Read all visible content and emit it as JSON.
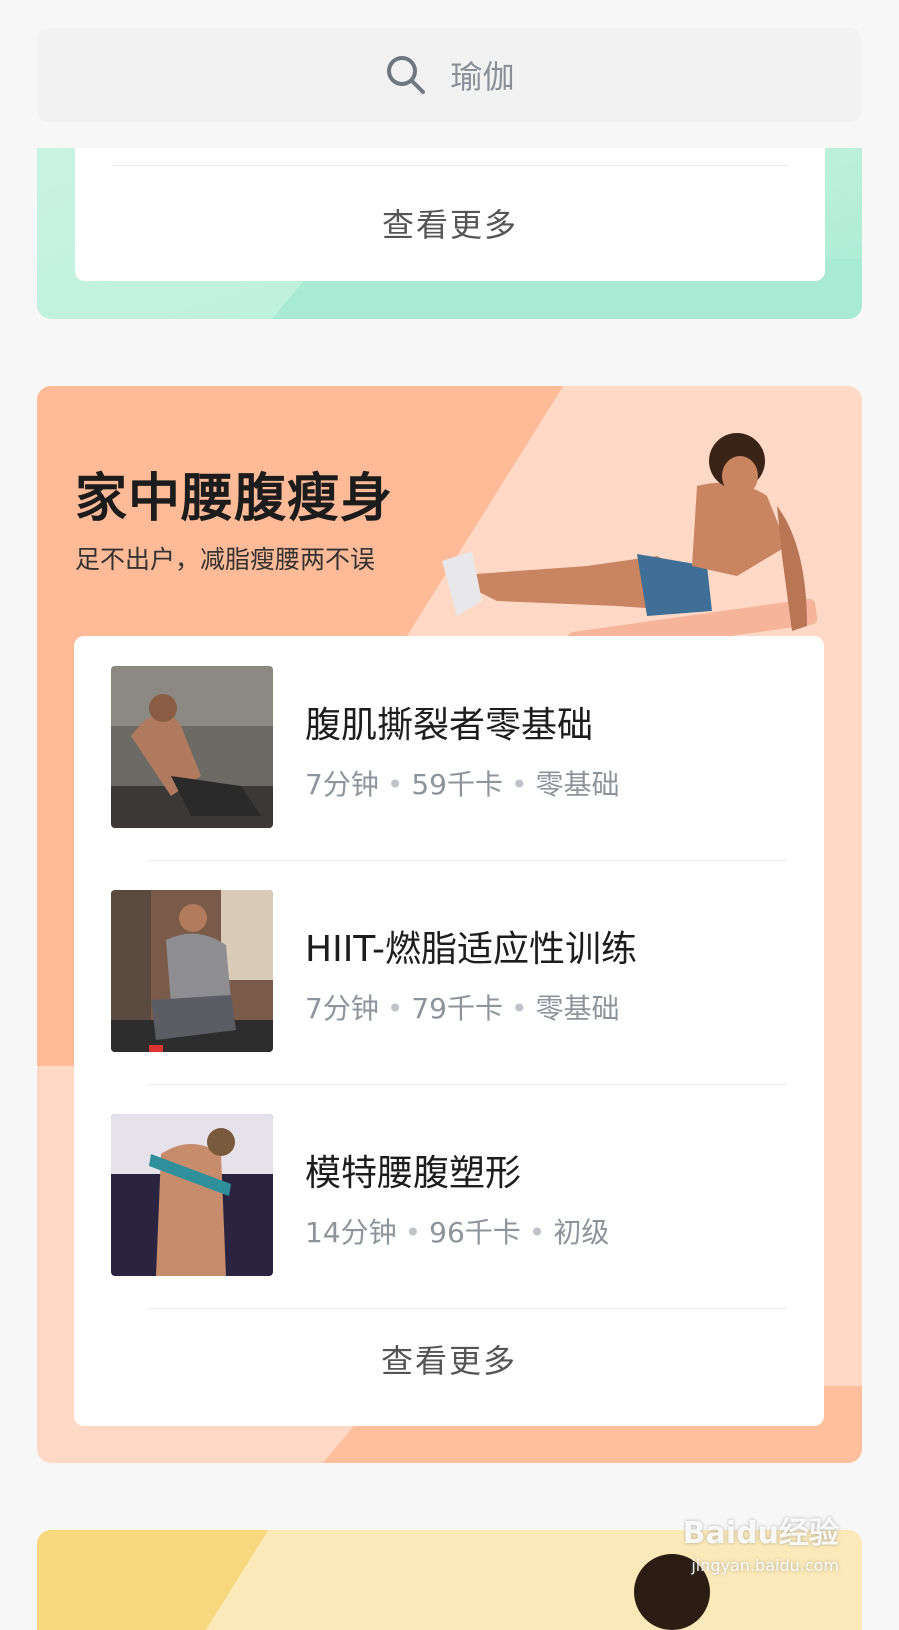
{
  "search": {
    "placeholder": "瑜伽",
    "icon": "search-icon"
  },
  "top_section": {
    "more_label": "查看更多"
  },
  "section": {
    "title": "家中腰腹瘦身",
    "subtitle": "足不出户，减脂瘦腰两不误",
    "items": [
      {
        "title": "腹肌撕裂者零基础",
        "duration": "7分钟",
        "calories": "59千卡",
        "level": "零基础"
      },
      {
        "title": "HIIT-燃脂适应性训练",
        "duration": "7分钟",
        "calories": "79千卡",
        "level": "零基础"
      },
      {
        "title": "模特腰腹塑形",
        "duration": "14分钟",
        "calories": "96千卡",
        "level": "初级"
      }
    ],
    "more_label": "查看更多"
  },
  "watermark": {
    "brand": "Baidu经验",
    "url": "jingyan.baidu.com"
  },
  "colors": {
    "green": "#bff0dd",
    "orange": "#ffd9c5",
    "yellow": "#fbe9b9"
  }
}
